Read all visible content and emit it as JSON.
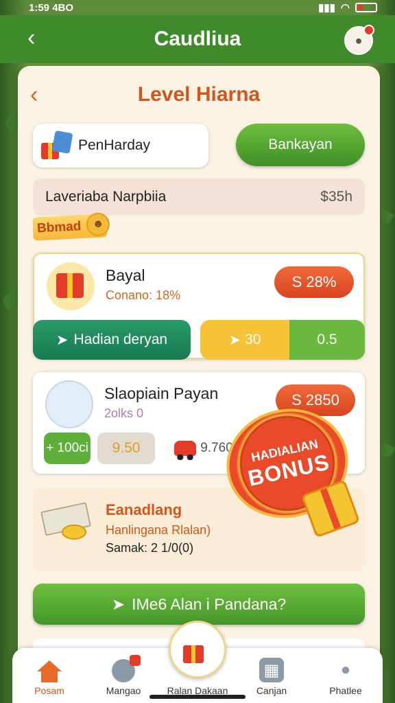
{
  "status": {
    "time": "1:59 4BO"
  },
  "appbar": {
    "title": "Caudliua"
  },
  "level": {
    "title": "Level Hiarna"
  },
  "top_row": {
    "card_label": "PenHarday",
    "button_label": "Bankayan"
  },
  "info_row": {
    "left": "Laveriaba Narpbiia",
    "right": "$35h"
  },
  "badge": {
    "label": "Bbmad"
  },
  "card1": {
    "name": "Bayal",
    "sub": "Conano: 18%",
    "price": "S 28%",
    "action_label": "Hadian deryan",
    "split_left": "30",
    "split_right": "0.5"
  },
  "card2": {
    "name": "Slaopiain Payan",
    "sub": "2olks 0",
    "price": "S 2850",
    "chip1": "+ 100ci",
    "chip2": "9.50",
    "chip3": "9.760"
  },
  "card3": {
    "name": "Eanadlang",
    "line2": "Hanlingana Rlalan)",
    "line3": "Samak: 2 1/0(0)"
  },
  "bonus": {
    "line1": "HADIALIAN",
    "line2": "BONUS"
  },
  "cta": {
    "label": "IMe6 Alan i Pandana?"
  },
  "tabs": [
    {
      "label": "Posam"
    },
    {
      "label": "Mangao"
    },
    {
      "label": "Ralan Dakaan"
    },
    {
      "label": "Canjan"
    },
    {
      "label": "Phatlee"
    }
  ],
  "colors": {
    "brand_green": "#3f8a2a",
    "accent_orange": "#d2561c",
    "price_red": "#d84420"
  },
  "icons": [
    "back-icon",
    "avatar-icon",
    "gift-icon",
    "smile-icon",
    "car-icon",
    "coins-icon",
    "home-icon",
    "globe-icon",
    "shop-icon",
    "profile-icon"
  ]
}
